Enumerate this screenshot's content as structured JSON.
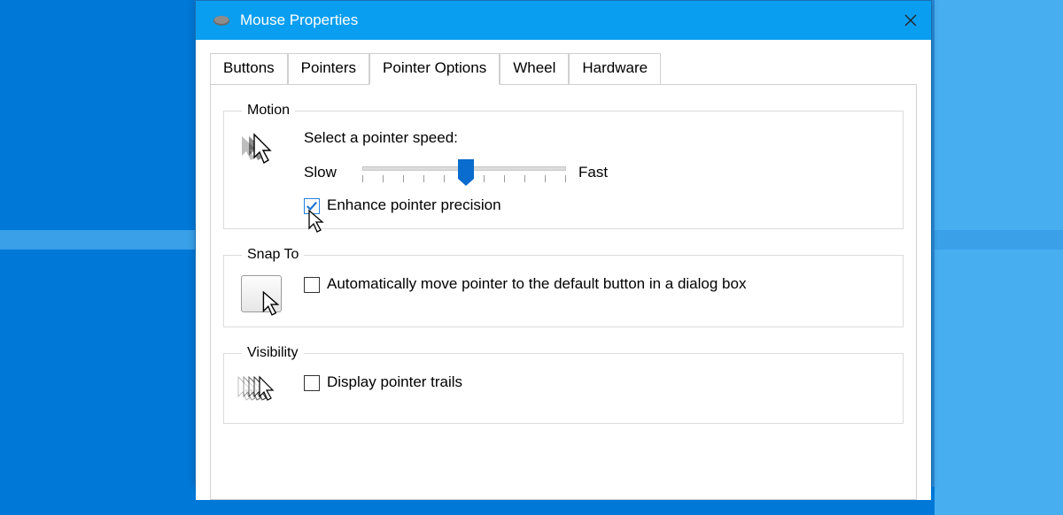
{
  "window": {
    "title": "Mouse Properties"
  },
  "tabs": [
    {
      "label": "Buttons",
      "active": false
    },
    {
      "label": "Pointers",
      "active": false
    },
    {
      "label": "Pointer Options",
      "active": true
    },
    {
      "label": "Wheel",
      "active": false
    },
    {
      "label": "Hardware",
      "active": false
    }
  ],
  "motion": {
    "group_label": "Motion",
    "speed_label": "Select a pointer speed:",
    "slow_label": "Slow",
    "fast_label": "Fast",
    "enhance_label": "Enhance pointer precision",
    "enhance_checked": true
  },
  "snap": {
    "group_label": "Snap To",
    "auto_label": "Automatically move pointer to the default button in a dialog box",
    "auto_checked": false
  },
  "visibility": {
    "group_label": "Visibility",
    "trails_label": "Display pointer trails",
    "trails_checked": false
  }
}
